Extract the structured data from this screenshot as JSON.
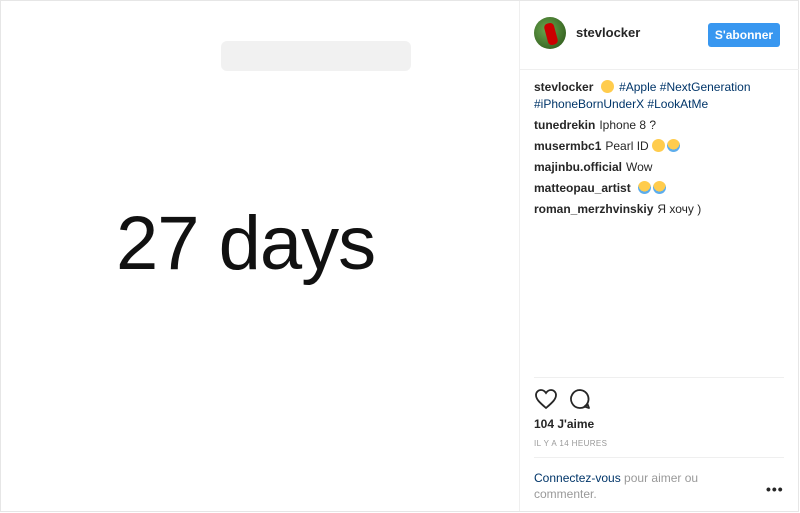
{
  "media": {
    "text": "27 days"
  },
  "header": {
    "username": "stevlocker",
    "follow_label": "S'abonner"
  },
  "caption": {
    "username": "stevlocker",
    "tags": [
      "#Apple",
      "#NextGeneration",
      "#iPhoneBornUnderX",
      "#LookAtMe"
    ]
  },
  "comments": [
    {
      "user": "tunedrekin",
      "text": "Iphone 8 ?"
    },
    {
      "user": "musermbc1",
      "text": "Pearl ID"
    },
    {
      "user": "majinbu.official",
      "text": "Wow"
    },
    {
      "user": "matteopau_artist",
      "text": ""
    },
    {
      "user": "roman_merzhvinskiy",
      "text": "Я хочу )"
    }
  ],
  "likes": "104 J'aime",
  "time": "IL Y A 14 HEURES",
  "login": {
    "link": "Connectez-vous",
    "rest": " pour aimer ou commenter."
  },
  "icons": {
    "like": "heart-icon",
    "comment": "comment-icon",
    "more": "more-options-icon"
  }
}
